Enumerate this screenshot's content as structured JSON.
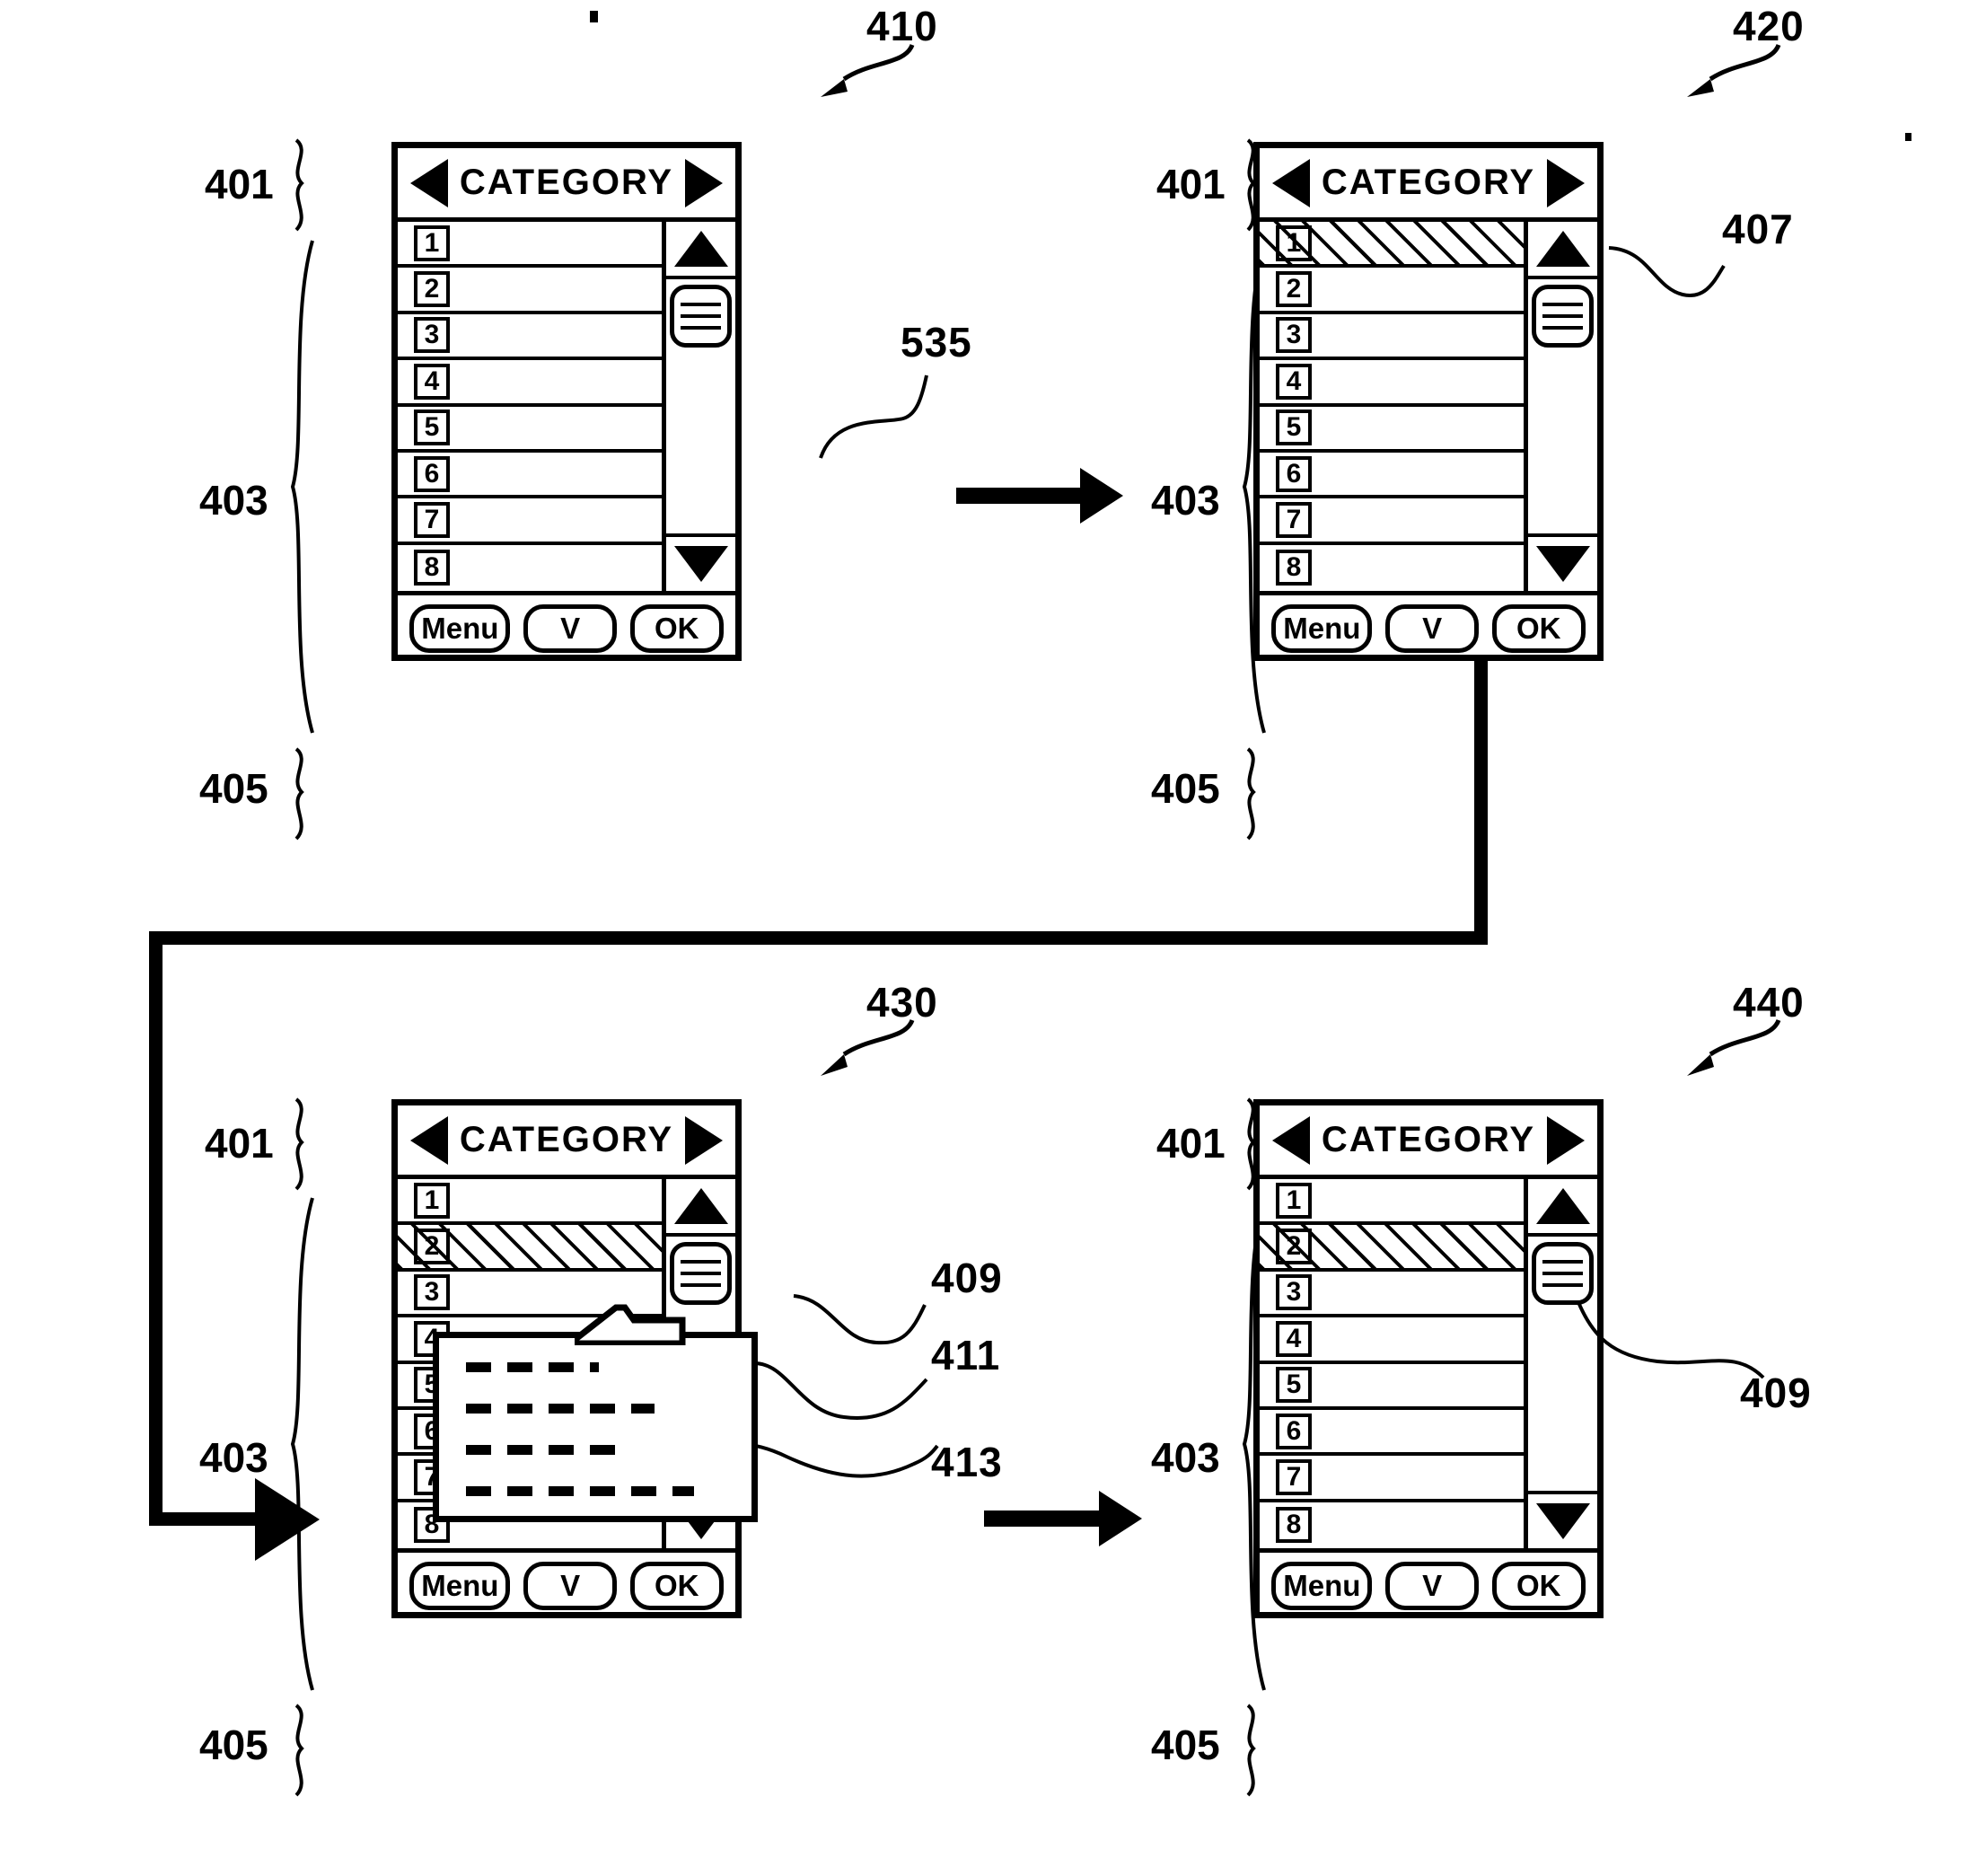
{
  "figure": {
    "panels": [
      {
        "id": "410",
        "ref_label": "410",
        "titlebar": {
          "title": "CATEGORY",
          "left_arrow": "prev-category",
          "right_arrow": "next-category"
        },
        "section_labels": {
          "titlebar": "401",
          "list": "403",
          "buttons": "405"
        },
        "rows": [
          {
            "num": "1",
            "selected": false
          },
          {
            "num": "2",
            "selected": false
          },
          {
            "num": "3",
            "selected": false
          },
          {
            "num": "4",
            "selected": false
          },
          {
            "num": "5",
            "selected": false
          },
          {
            "num": "6",
            "selected": false
          },
          {
            "num": "7",
            "selected": false
          },
          {
            "num": "8",
            "selected": false
          }
        ],
        "buttons": [
          "Menu",
          "V",
          "OK"
        ],
        "callouts": [
          {
            "num": "535"
          }
        ],
        "popup": null
      },
      {
        "id": "420",
        "ref_label": "420",
        "titlebar": {
          "title": "CATEGORY",
          "left_arrow": "prev-category",
          "right_arrow": "next-category"
        },
        "section_labels": {
          "titlebar": "401",
          "list": "403",
          "buttons": "405"
        },
        "rows": [
          {
            "num": "1",
            "selected": true
          },
          {
            "num": "2",
            "selected": false
          },
          {
            "num": "3",
            "selected": false
          },
          {
            "num": "4",
            "selected": false
          },
          {
            "num": "5",
            "selected": false
          },
          {
            "num": "6",
            "selected": false
          },
          {
            "num": "7",
            "selected": false
          },
          {
            "num": "8",
            "selected": false
          }
        ],
        "buttons": [
          "Menu",
          "V",
          "OK"
        ],
        "callouts": [
          {
            "num": "407"
          }
        ],
        "popup": null
      },
      {
        "id": "430",
        "ref_label": "430",
        "titlebar": {
          "title": "CATEGORY",
          "left_arrow": "prev-category",
          "right_arrow": "next-category"
        },
        "section_labels": {
          "titlebar": "401",
          "list": "403",
          "buttons": "405"
        },
        "rows": [
          {
            "num": "1",
            "selected": false
          },
          {
            "num": "2",
            "selected": true
          },
          {
            "num": "3",
            "selected": false
          },
          {
            "num": "4",
            "selected": false
          },
          {
            "num": "5",
            "selected": false
          },
          {
            "num": "6",
            "selected": false
          },
          {
            "num": "7",
            "selected": false
          },
          {
            "num": "8",
            "selected": false
          }
        ],
        "buttons": [
          "Menu",
          "V",
          "OK"
        ],
        "callouts": [
          {
            "num": "409"
          },
          {
            "num": "411"
          },
          {
            "num": "413"
          }
        ],
        "popup": {
          "lines": 4,
          "content": "dashed-placeholder-text"
        }
      },
      {
        "id": "440",
        "ref_label": "440",
        "titlebar": {
          "title": "CATEGORY",
          "left_arrow": "prev-category",
          "right_arrow": "next-category"
        },
        "section_labels": {
          "titlebar": "401",
          "list": "403",
          "buttons": "405"
        },
        "rows": [
          {
            "num": "1",
            "selected": false
          },
          {
            "num": "2",
            "selected": true
          },
          {
            "num": "3",
            "selected": false
          },
          {
            "num": "4",
            "selected": false
          },
          {
            "num": "5",
            "selected": false
          },
          {
            "num": "6",
            "selected": false
          },
          {
            "num": "7",
            "selected": false
          },
          {
            "num": "8",
            "selected": false
          }
        ],
        "buttons": [
          "Menu",
          "V",
          "OK"
        ],
        "callouts": [
          {
            "num": "409"
          }
        ],
        "popup": null
      }
    ]
  },
  "colors": {
    "ink": "#000000",
    "paper": "#ffffff"
  }
}
